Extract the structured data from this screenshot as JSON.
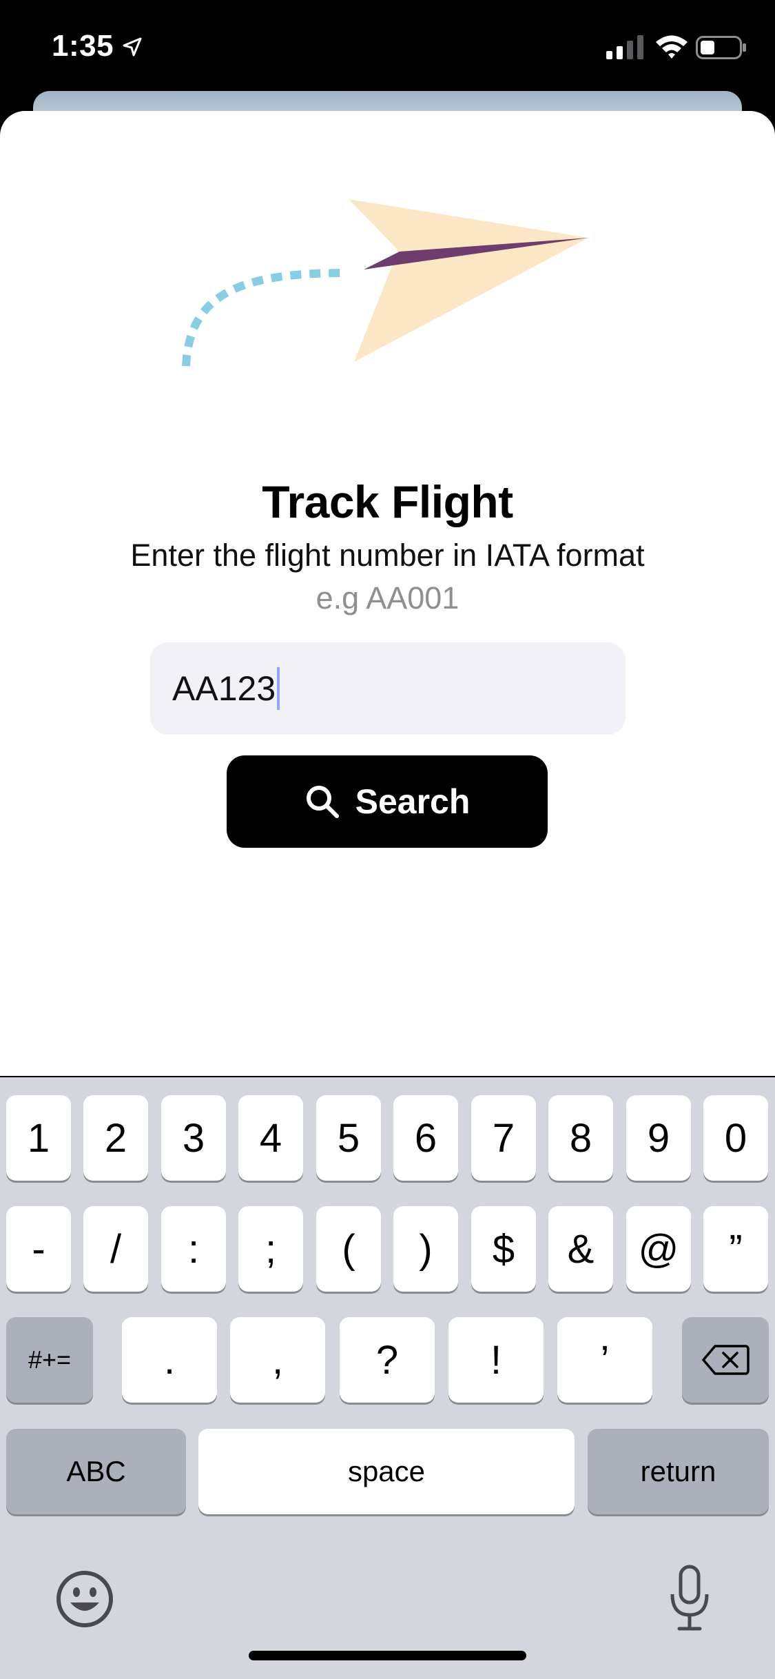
{
  "status_bar": {
    "time": "1:35",
    "icons": [
      "location-arrow-icon",
      "signal-icon",
      "wifi-icon",
      "battery-icon"
    ]
  },
  "screen": {
    "title": "Track Flight",
    "subtitle": "Enter the flight number in IATA format",
    "example": "e.g AA001",
    "flight_input": {
      "value": "AA123"
    },
    "search_button": {
      "label": "Search",
      "icon": "search-icon"
    }
  },
  "keyboard": {
    "row1": [
      "1",
      "2",
      "3",
      "4",
      "5",
      "6",
      "7",
      "8",
      "9",
      "0"
    ],
    "row2": [
      "-",
      "/",
      ":",
      ";",
      "(",
      ")",
      "$",
      "&",
      "@",
      "”"
    ],
    "row3": {
      "shift_label": "#+=",
      "keys": [
        ".",
        ",",
        "?",
        "!",
        "’"
      ],
      "delete_icon": "backspace-icon"
    },
    "row4": {
      "abc_label": "ABC",
      "space_label": "space",
      "return_label": "return"
    },
    "bottom_icons": [
      "emoji-icon",
      "microphone-icon"
    ]
  },
  "colors": {
    "background": "#ffffff",
    "input_bg": "#f1f1f6",
    "button_bg": "#000000",
    "muted_text": "#8e8e93",
    "keyboard_bg": "#d3d6dc",
    "plane_wing": "#fbe7c6",
    "plane_fold": "#6e3d6e",
    "trail": "#89cde4"
  }
}
